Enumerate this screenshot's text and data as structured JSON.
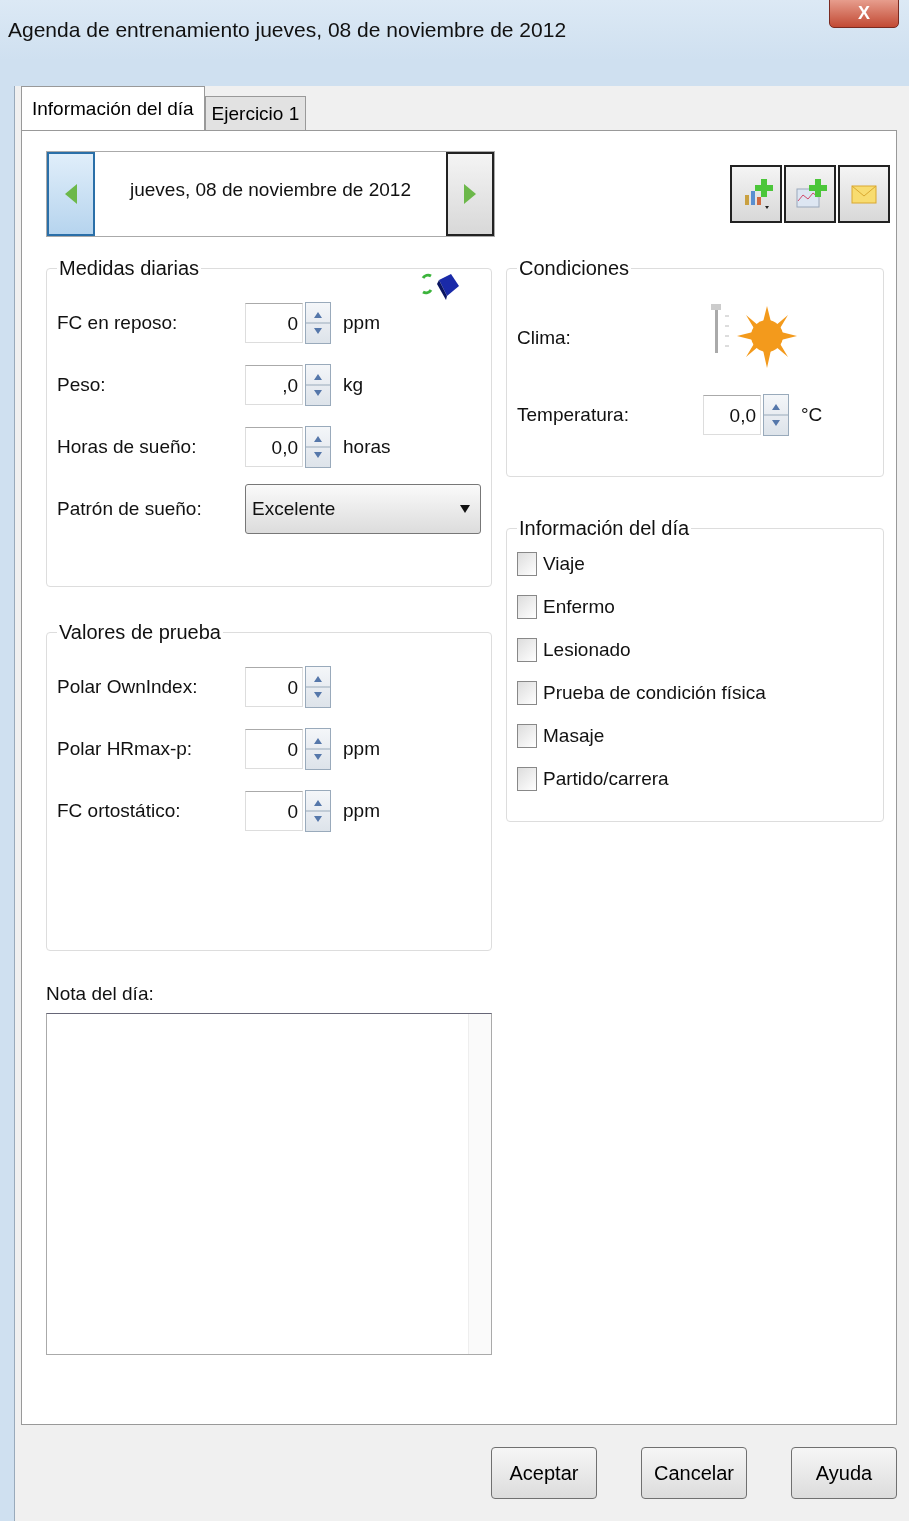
{
  "window": {
    "title": "Agenda de entrenamiento   jueves, 08 de noviembre de 2012",
    "close": "X"
  },
  "tabs": [
    {
      "label": "Información del día",
      "selected": true
    },
    {
      "label": "Ejercicio 1",
      "selected": false
    }
  ],
  "date_navigator": {
    "date": "jueves, 08 de noviembre de 2012"
  },
  "daily_measures": {
    "title": "Medidas diarias",
    "fields": [
      {
        "label": "FC en reposo:",
        "value": "0",
        "unit": "ppm"
      },
      {
        "label": "Peso:",
        "value": ",0",
        "unit": "kg"
      },
      {
        "label": "Horas de sueño:",
        "value": "0,0",
        "unit": "horas"
      }
    ],
    "sleep_pattern": {
      "label": "Patrón de sueño:",
      "value": "Excelente"
    }
  },
  "test_values": {
    "title": "Valores de prueba",
    "fields": [
      {
        "label": "Polar OwnIndex:",
        "value": "0"
      },
      {
        "label": "Polar HRmax-p:",
        "value": "0",
        "unit": "ppm"
      },
      {
        "label": "FC ortostático:",
        "value": "0",
        "unit": "ppm"
      }
    ]
  },
  "conditions": {
    "title": "Condiciones",
    "weather_label": "Clima:",
    "temperature": {
      "label": "Temperatura:",
      "value": "0,0",
      "unit": "°C"
    }
  },
  "day_info": {
    "title": "Información del día",
    "items": [
      {
        "label": "Viaje",
        "checked": false
      },
      {
        "label": "Enfermo",
        "checked": false
      },
      {
        "label": "Lesionado",
        "checked": false
      },
      {
        "label": "Prueba de condición física",
        "checked": false
      },
      {
        "label": "Masaje",
        "checked": false
      },
      {
        "label": "Partido/carrera",
        "checked": false
      }
    ]
  },
  "note": {
    "label": "Nota del día:"
  },
  "buttons": [
    "Aceptar",
    "Cancelar",
    "Ayuda"
  ]
}
